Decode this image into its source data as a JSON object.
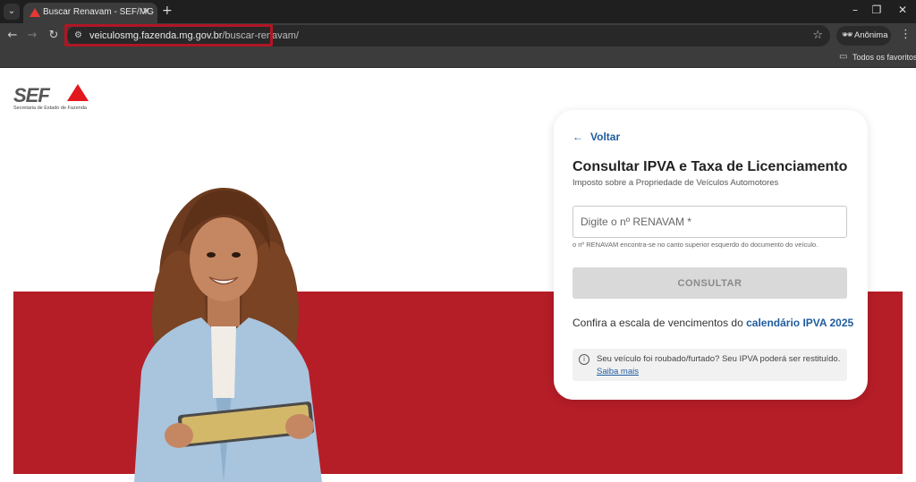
{
  "browser": {
    "tab_title": "Buscar Renavam - SEF/MG",
    "url_domain": "veiculosmg.fazenda.mg.gov.br",
    "url_path": "/buscar-renavam/",
    "incognito_label": "Anônima",
    "bookmarks_folder": "Todos os favoritos"
  },
  "logo": {
    "wordmark": "SEF",
    "subtitle": "Secretaria de Estado de Fazenda"
  },
  "card": {
    "back_label": "Voltar",
    "title": "Consultar IPVA e Taxa de Licenciamento",
    "subtitle": "Imposto sobre a Propriedade de Veículos Automotores",
    "input_placeholder": "Digite o nº RENAVAM *",
    "input_value": "",
    "hint": "o nº RENAVAM encontra-se no canto superior esquerdo do documento do veículo.",
    "button_label": "CONSULTAR",
    "calendar_text": "Confira a escala de vencimentos do ",
    "calendar_link": "calendário IPVA 2025",
    "notice_text": "Seu veículo foi roubado/furtado? Seu IPVA poderá ser restituído.",
    "notice_link": "Saiba mais"
  },
  "colors": {
    "brand_red": "#b51d27",
    "link_blue": "#1f5c9e",
    "url_highlight": "#b01624"
  }
}
